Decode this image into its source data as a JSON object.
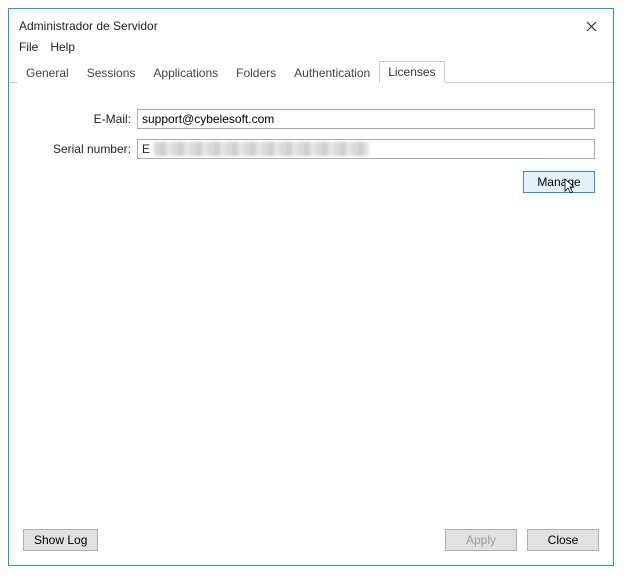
{
  "window": {
    "title": "Administrador de Servidor",
    "close_icon": "✕"
  },
  "menu": {
    "file": "File",
    "help": "Help"
  },
  "tabs": {
    "general": "General",
    "sessions": "Sessions",
    "applications": "Applications",
    "folders": "Folders",
    "authentication": "Authentication",
    "licenses": "Licenses",
    "active": "licenses"
  },
  "form": {
    "email_label": "E-Mail:",
    "email_value": "support@cybelesoft.com",
    "serial_label": "Serial number:",
    "serial_prefix": "E",
    "manage_label": "Manage"
  },
  "footer": {
    "show_log": "Show Log",
    "apply": "Apply",
    "close": "Close"
  }
}
